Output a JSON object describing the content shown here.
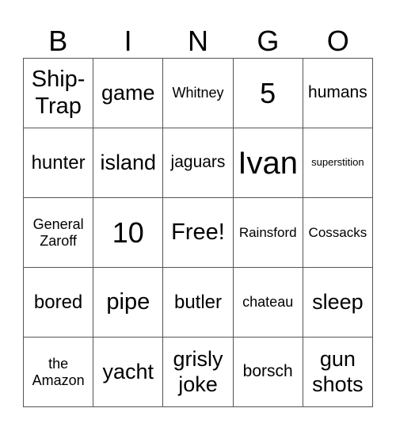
{
  "header": [
    "B",
    "I",
    "N",
    "G",
    "O"
  ],
  "cells": [
    [
      "Ship-Trap",
      "game",
      "Whitney",
      "5",
      "humans"
    ],
    [
      "hunter",
      "island",
      "jaguars",
      "Ivan",
      "superstition"
    ],
    [
      "General Zaroff",
      "10",
      "Free!",
      "Rainsford",
      "Cossacks"
    ],
    [
      "bored",
      "pipe",
      "butler",
      "chateau",
      "sleep"
    ],
    [
      "the Amazon",
      "yacht",
      "grisly joke",
      "borsch",
      "gun shots"
    ]
  ]
}
